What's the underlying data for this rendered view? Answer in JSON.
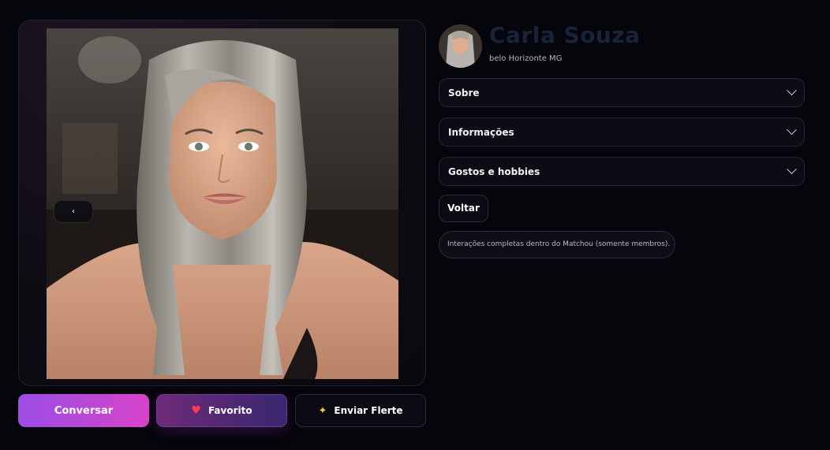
{
  "profile": {
    "name": "Carla Souza",
    "location": "belo Horizonte MG"
  },
  "gallery": {
    "prev_label": "‹",
    "next_label": "›"
  },
  "actions": {
    "chat_label": "Conversar",
    "favorite_label": "Favorito",
    "favorite_icon": "heart-icon",
    "flirt_label": "Enviar Flerte",
    "flirt_icon": "sparkles-icon"
  },
  "sections": [
    {
      "label": "Sobre"
    },
    {
      "label": "Informações"
    },
    {
      "label": "Gostos e hobbies"
    }
  ],
  "back_label": "Voltar",
  "notice": "Interações completas dentro do Matchou (somente membros).",
  "colors": {
    "background": "#05050c",
    "accent_gradient_start": "#9b4de6",
    "accent_gradient_end": "#d843c8",
    "heart": "#ff3b5c",
    "name_text": "#18233a"
  }
}
